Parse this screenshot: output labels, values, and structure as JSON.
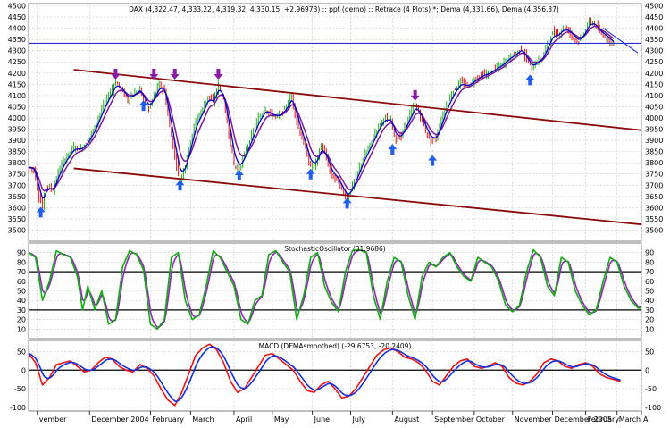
{
  "colors": {
    "background": "#ffffff",
    "frame": "#7f7f7f",
    "grid": "#c8c8c8",
    "up_bar": "#22aa22",
    "down_bar": "#dd1111",
    "dema_fast": "#0000cc",
    "dema_slow": "#7a1a9a",
    "channel": "#8b0a0a",
    "hline": "#2030dd",
    "stoch_k": "#11aa11",
    "stoch_d": "#8a2ab0",
    "level_line": "#000000",
    "macd_line": "#ee1111",
    "signal_line": "#1030dd",
    "arrow_up": "#1e5ff0",
    "arrow_down": "#8a1aa6"
  },
  "chart_data": [
    {
      "type": "line",
      "title": "DAX (4,322.47, 4,333.22, 4,319.32, 4,330.15, +2.96973) :: ppt (demo) :: Retrace (4 Plots) *; Dema (4,331.66), Dema (4,356.37)",
      "xlabel": "",
      "ylabel": "",
      "ylim": [
        3450,
        4510
      ],
      "yticks": [
        3500,
        3550,
        3600,
        3650,
        3700,
        3750,
        3800,
        3850,
        3900,
        3950,
        4000,
        4050,
        4100,
        4150,
        4200,
        4250,
        4300,
        4350,
        4400,
        4450,
        4500
      ],
      "ytick_labels": [
        "3500",
        "3550",
        "3600",
        "3650",
        "3700",
        "3750",
        "3800",
        "3850",
        "3900",
        "3950",
        "4000",
        "4050",
        "4100",
        "4150",
        "4200",
        "4250",
        "4300",
        "4350",
        "4400",
        "4450",
        "4500"
      ],
      "x_range": [
        0,
        352
      ],
      "price_anchors": [
        [
          0,
          3780
        ],
        [
          3,
          3770
        ],
        [
          6,
          3650
        ],
        [
          8,
          3600
        ],
        [
          10,
          3700
        ],
        [
          14,
          3680
        ],
        [
          17,
          3760
        ],
        [
          21,
          3820
        ],
        [
          26,
          3870
        ],
        [
          30,
          3860
        ],
        [
          34,
          3900
        ],
        [
          38,
          3960
        ],
        [
          42,
          4040
        ],
        [
          46,
          4100
        ],
        [
          50,
          4160
        ],
        [
          53,
          4130
        ],
        [
          57,
          4080
        ],
        [
          61,
          4110
        ],
        [
          64,
          4130
        ],
        [
          66,
          4080
        ],
        [
          69,
          4040
        ],
        [
          72,
          4100
        ],
        [
          75,
          4150
        ],
        [
          78,
          4120
        ],
        [
          81,
          3960
        ],
        [
          84,
          3830
        ],
        [
          87,
          3720
        ],
        [
          90,
          3790
        ],
        [
          93,
          3900
        ],
        [
          96,
          3990
        ],
        [
          100,
          4040
        ],
        [
          103,
          4100
        ],
        [
          106,
          4070
        ],
        [
          109,
          4150
        ],
        [
          112,
          4080
        ],
        [
          115,
          3930
        ],
        [
          118,
          3790
        ],
        [
          121,
          3770
        ],
        [
          124,
          3840
        ],
        [
          128,
          3920
        ],
        [
          132,
          4000
        ],
        [
          136,
          4040
        ],
        [
          140,
          4010
        ],
        [
          144,
          4010
        ],
        [
          148,
          4050
        ],
        [
          151,
          4100
        ],
        [
          153,
          4020
        ],
        [
          156,
          3930
        ],
        [
          159,
          3860
        ],
        [
          162,
          3780
        ],
        [
          165,
          3800
        ],
        [
          168,
          3880
        ],
        [
          171,
          3820
        ],
        [
          174,
          3740
        ],
        [
          177,
          3730
        ],
        [
          180,
          3680
        ],
        [
          183,
          3640
        ],
        [
          186,
          3700
        ],
        [
          189,
          3760
        ],
        [
          192,
          3820
        ],
        [
          196,
          3880
        ],
        [
          200,
          3950
        ],
        [
          204,
          4000
        ],
        [
          208,
          3990
        ],
        [
          211,
          3900
        ],
        [
          214,
          3920
        ],
        [
          218,
          4000
        ],
        [
          222,
          4060
        ],
        [
          225,
          4010
        ],
        [
          228,
          3940
        ],
        [
          231,
          3900
        ],
        [
          234,
          3910
        ],
        [
          237,
          3990
        ],
        [
          240,
          4060
        ],
        [
          244,
          4120
        ],
        [
          248,
          4160
        ],
        [
          252,
          4140
        ],
        [
          256,
          4170
        ],
        [
          260,
          4190
        ],
        [
          264,
          4200
        ],
        [
          268,
          4220
        ],
        [
          272,
          4240
        ],
        [
          276,
          4270
        ],
        [
          280,
          4290
        ],
        [
          283,
          4310
        ],
        [
          286,
          4260
        ],
        [
          289,
          4220
        ],
        [
          292,
          4250
        ],
        [
          295,
          4270
        ],
        [
          298,
          4330
        ],
        [
          301,
          4380
        ],
        [
          304,
          4370
        ],
        [
          307,
          4400
        ],
        [
          310,
          4390
        ],
        [
          313,
          4360
        ],
        [
          316,
          4340
        ],
        [
          319,
          4380
        ],
        [
          322,
          4430
        ],
        [
          325,
          4420
        ],
        [
          328,
          4380
        ],
        [
          332,
          4360
        ],
        [
          336,
          4330
        ]
      ],
      "horizontal_line": 4333,
      "channels": [
        {
          "name": "upper",
          "points": [
            [
              26,
              4215
            ],
            [
              352,
              3945
            ]
          ]
        },
        {
          "name": "lower",
          "points": [
            [
              26,
              3775
            ],
            [
              352,
              3525
            ]
          ]
        }
      ],
      "markers": [
        {
          "x": 7,
          "y": 3580,
          "direction": "up"
        },
        {
          "x": 50,
          "y": 4195,
          "direction": "down"
        },
        {
          "x": 66,
          "y": 4055,
          "direction": "up"
        },
        {
          "x": 72,
          "y": 4195,
          "direction": "down"
        },
        {
          "x": 84,
          "y": 4195,
          "direction": "down"
        },
        {
          "x": 87,
          "y": 3700,
          "direction": "up"
        },
        {
          "x": 109,
          "y": 4195,
          "direction": "down"
        },
        {
          "x": 121,
          "y": 3745,
          "direction": "up"
        },
        {
          "x": 162,
          "y": 3750,
          "direction": "up"
        },
        {
          "x": 183,
          "y": 3620,
          "direction": "up"
        },
        {
          "x": 209,
          "y": 3860,
          "direction": "up"
        },
        {
          "x": 222,
          "y": 4100,
          "direction": "down"
        },
        {
          "x": 232,
          "y": 3810,
          "direction": "up"
        },
        {
          "x": 288,
          "y": 4170,
          "direction": "up"
        }
      ]
    },
    {
      "type": "line",
      "title": "StochasticOscillator (31.9686)",
      "xlabel": "",
      "ylabel": "",
      "ylim": [
        0,
        100
      ],
      "yticks": [
        10,
        20,
        30,
        40,
        50,
        60,
        70,
        80,
        90
      ],
      "ytick_labels": [
        "10",
        "20",
        "30",
        "40",
        "50",
        "60",
        "70",
        "80",
        "90"
      ],
      "levels": [
        30,
        70
      ],
      "series": [
        {
          "name": "",
          "role": "%K"
        },
        {
          "name": "",
          "role": "%D"
        }
      ],
      "k_anchors": [
        [
          0,
          90
        ],
        [
          4,
          85
        ],
        [
          8,
          40
        ],
        [
          12,
          60
        ],
        [
          16,
          92
        ],
        [
          20,
          88
        ],
        [
          24,
          85
        ],
        [
          28,
          65
        ],
        [
          31,
          30
        ],
        [
          34,
          55
        ],
        [
          38,
          30
        ],
        [
          42,
          50
        ],
        [
          46,
          15
        ],
        [
          50,
          20
        ],
        [
          54,
          75
        ],
        [
          58,
          92
        ],
        [
          62,
          88
        ],
        [
          66,
          72
        ],
        [
          70,
          15
        ],
        [
          74,
          10
        ],
        [
          78,
          20
        ],
        [
          82,
          85
        ],
        [
          86,
          90
        ],
        [
          90,
          40
        ],
        [
          94,
          20
        ],
        [
          98,
          25
        ],
        [
          102,
          55
        ],
        [
          106,
          92
        ],
        [
          110,
          85
        ],
        [
          114,
          70
        ],
        [
          118,
          55
        ],
        [
          122,
          20
        ],
        [
          126,
          15
        ],
        [
          130,
          40
        ],
        [
          134,
          45
        ],
        [
          138,
          88
        ],
        [
          142,
          92
        ],
        [
          146,
          80
        ],
        [
          150,
          70
        ],
        [
          154,
          20
        ],
        [
          158,
          45
        ],
        [
          162,
          85
        ],
        [
          166,
          90
        ],
        [
          170,
          55
        ],
        [
          174,
          38
        ],
        [
          178,
          28
        ],
        [
          182,
          70
        ],
        [
          186,
          92
        ],
        [
          190,
          93
        ],
        [
          194,
          90
        ],
        [
          198,
          45
        ],
        [
          202,
          20
        ],
        [
          206,
          60
        ],
        [
          210,
          85
        ],
        [
          214,
          80
        ],
        [
          218,
          45
        ],
        [
          222,
          20
        ],
        [
          226,
          65
        ],
        [
          230,
          80
        ],
        [
          234,
          75
        ],
        [
          238,
          85
        ],
        [
          242,
          90
        ],
        [
          246,
          75
        ],
        [
          250,
          65
        ],
        [
          254,
          60
        ],
        [
          258,
          85
        ],
        [
          262,
          80
        ],
        [
          266,
          75
        ],
        [
          270,
          60
        ],
        [
          274,
          35
        ],
        [
          278,
          28
        ],
        [
          282,
          35
        ],
        [
          286,
          70
        ],
        [
          290,
          93
        ],
        [
          294,
          85
        ],
        [
          298,
          55
        ],
        [
          302,
          45
        ],
        [
          306,
          85
        ],
        [
          310,
          80
        ],
        [
          314,
          50
        ],
        [
          318,
          35
        ],
        [
          322,
          25
        ],
        [
          326,
          30
        ],
        [
          330,
          60
        ],
        [
          334,
          85
        ],
        [
          338,
          80
        ],
        [
          342,
          55
        ],
        [
          346,
          40
        ],
        [
          350,
          32
        ]
      ]
    },
    {
      "type": "line",
      "title": "MACD (DEMAsmoothed) (-29.6753, -20.2409)",
      "xlabel": "",
      "ylabel": "",
      "ylim": [
        -110,
        80
      ],
      "yticks": [
        -100,
        -50,
        0,
        50
      ],
      "ytick_labels": [
        "-100",
        "-50",
        "0",
        "50"
      ],
      "levels": [
        0
      ],
      "series": [
        {
          "name": "",
          "role": "macd"
        },
        {
          "name": "",
          "role": "signal"
        }
      ],
      "macd_anchors": [
        [
          0,
          45
        ],
        [
          4,
          20
        ],
        [
          8,
          -40
        ],
        [
          12,
          -20
        ],
        [
          16,
          15
        ],
        [
          20,
          20
        ],
        [
          24,
          25
        ],
        [
          28,
          10
        ],
        [
          32,
          -5
        ],
        [
          36,
          0
        ],
        [
          40,
          20
        ],
        [
          44,
          35
        ],
        [
          48,
          30
        ],
        [
          52,
          10
        ],
        [
          56,
          0
        ],
        [
          60,
          -5
        ],
        [
          64,
          15
        ],
        [
          68,
          5
        ],
        [
          72,
          -15
        ],
        [
          76,
          -50
        ],
        [
          80,
          -80
        ],
        [
          84,
          -95
        ],
        [
          88,
          -60
        ],
        [
          92,
          -10
        ],
        [
          96,
          40
        ],
        [
          100,
          60
        ],
        [
          104,
          70
        ],
        [
          108,
          55
        ],
        [
          112,
          20
        ],
        [
          116,
          -30
        ],
        [
          120,
          -60
        ],
        [
          124,
          -50
        ],
        [
          128,
          -20
        ],
        [
          132,
          10
        ],
        [
          136,
          40
        ],
        [
          140,
          45
        ],
        [
          144,
          30
        ],
        [
          148,
          15
        ],
        [
          152,
          0
        ],
        [
          156,
          -30
        ],
        [
          160,
          -55
        ],
        [
          164,
          -60
        ],
        [
          168,
          -40
        ],
        [
          172,
          -30
        ],
        [
          176,
          -50
        ],
        [
          180,
          -75
        ],
        [
          184,
          -70
        ],
        [
          188,
          -50
        ],
        [
          192,
          -20
        ],
        [
          196,
          10
        ],
        [
          200,
          40
        ],
        [
          204,
          55
        ],
        [
          208,
          60
        ],
        [
          212,
          50
        ],
        [
          216,
          35
        ],
        [
          220,
          30
        ],
        [
          224,
          20
        ],
        [
          228,
          0
        ],
        [
          232,
          -30
        ],
        [
          236,
          -40
        ],
        [
          240,
          -15
        ],
        [
          244,
          10
        ],
        [
          248,
          25
        ],
        [
          252,
          30
        ],
        [
          256,
          10
        ],
        [
          260,
          5
        ],
        [
          264,
          10
        ],
        [
          268,
          20
        ],
        [
          272,
          10
        ],
        [
          276,
          -20
        ],
        [
          280,
          -35
        ],
        [
          284,
          -40
        ],
        [
          288,
          -30
        ],
        [
          292,
          -10
        ],
        [
          296,
          20
        ],
        [
          300,
          30
        ],
        [
          304,
          25
        ],
        [
          308,
          10
        ],
        [
          312,
          5
        ],
        [
          316,
          15
        ],
        [
          320,
          20
        ],
        [
          324,
          10
        ],
        [
          328,
          -10
        ],
        [
          332,
          -20
        ],
        [
          336,
          -25
        ],
        [
          340,
          -30
        ]
      ]
    }
  ],
  "x_axis": {
    "labels": [
      {
        "x": 5,
        "text": "vember"
      },
      {
        "x": 35,
        "text": "December 2004"
      },
      {
        "x": 70,
        "text": "February"
      },
      {
        "x": 93,
        "text": "March"
      },
      {
        "x": 118,
        "text": "April"
      },
      {
        "x": 140,
        "text": "May"
      },
      {
        "x": 163,
        "text": "June"
      },
      {
        "x": 185,
        "text": "July"
      },
      {
        "x": 209,
        "text": "August"
      },
      {
        "x": 232,
        "text": "September"
      },
      {
        "x": 256,
        "text": "October"
      },
      {
        "x": 278,
        "text": "November"
      },
      {
        "x": 301,
        "text": "December 2005"
      },
      {
        "x": 320,
        "text": "February"
      },
      {
        "x": 338,
        "text": "March"
      },
      {
        "x": 352,
        "text": "A"
      }
    ]
  }
}
